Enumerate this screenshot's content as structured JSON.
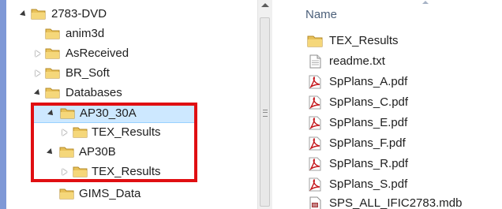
{
  "tree": {
    "items": [
      {
        "label": "2783-DVD",
        "state": "expanded"
      },
      {
        "label": "anim3d",
        "state": "none"
      },
      {
        "label": "AsReceived",
        "state": "collapsed"
      },
      {
        "label": "BR_Soft",
        "state": "collapsed"
      },
      {
        "label": "Databases",
        "state": "expanded"
      },
      {
        "label": "AP30_30A",
        "state": "expanded",
        "selected": true
      },
      {
        "label": "TEX_Results",
        "state": "collapsed"
      },
      {
        "label": "AP30B",
        "state": "expanded"
      },
      {
        "label": "TEX_Results",
        "state": "collapsed"
      },
      {
        "label": "GIMS_Data",
        "state": "none"
      }
    ]
  },
  "files": {
    "column_header": "Name",
    "items": [
      {
        "name": "TEX_Results",
        "icon": "folder-icon"
      },
      {
        "name": "readme.txt",
        "icon": "text-file-icon"
      },
      {
        "name": "SpPlans_A.pdf",
        "icon": "pdf-icon"
      },
      {
        "name": "SpPlans_C.pdf",
        "icon": "pdf-icon"
      },
      {
        "name": "SpPlans_E.pdf",
        "icon": "pdf-icon"
      },
      {
        "name": "SpPlans_F.pdf",
        "icon": "pdf-icon"
      },
      {
        "name": "SpPlans_R.pdf",
        "icon": "pdf-icon"
      },
      {
        "name": "SpPlans_S.pdf",
        "icon": "pdf-icon"
      },
      {
        "name": "SPS_ALL_IFIC2783.mdb",
        "icon": "database-file-icon"
      }
    ]
  },
  "colors": {
    "selection": "#cde8ff",
    "highlight_box": "#e00f12",
    "folder": "#e8c15a",
    "pdf": "#c4161c",
    "background": "#7f98d6"
  }
}
